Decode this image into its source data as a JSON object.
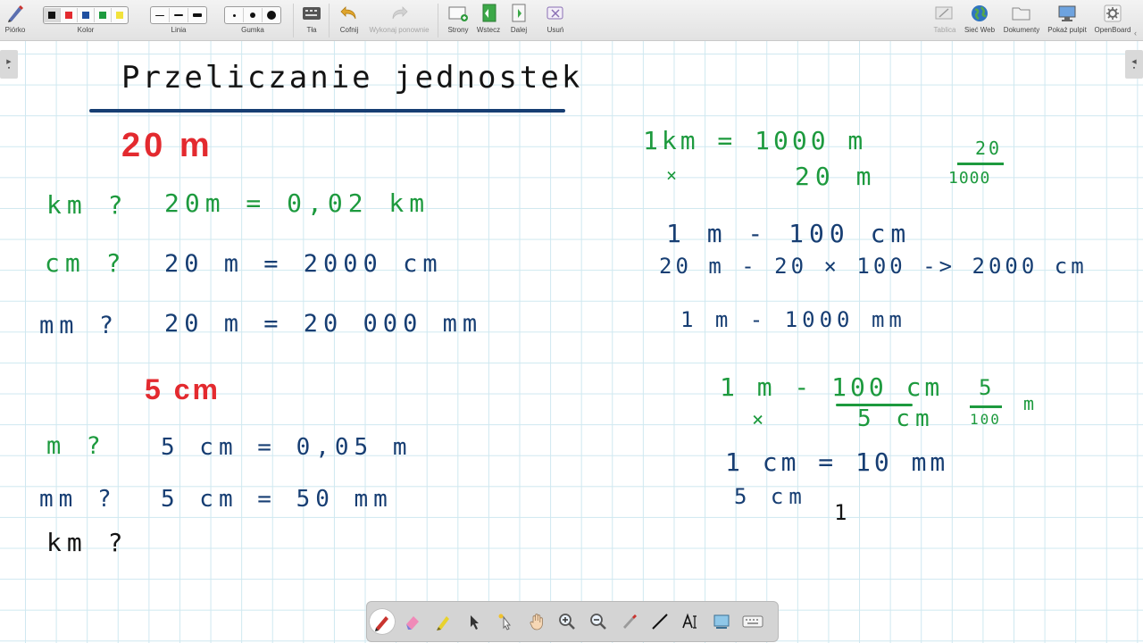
{
  "toolbar": {
    "pen_label": "Piórko",
    "color_label": "Kolor",
    "line_label": "Linia",
    "eraser_label": "Gumka",
    "background_label": "Tła",
    "undo_label": "Cofnij",
    "redo_label": "Wykonaj ponownie",
    "pages_label": "Strony",
    "back_label": "Wstecz",
    "next_label": "Dalej",
    "delete_label": "Usuń",
    "board_label": "Tablica",
    "web_label": "Sieć Web",
    "documents_label": "Dokumenty",
    "desktop_label": "Pokaż pulpit",
    "app_label": "OpenBoard",
    "colors": [
      "#111111",
      "#e32a2f",
      "#1f4fa0",
      "#1d9a3e",
      "#f2e23a"
    ]
  },
  "board": {
    "title": "Przeliczanie jednostek",
    "left": {
      "value_1": "20 m",
      "q1_unit": "km ?",
      "q1_answer": "20m = 0,02 km",
      "q2_unit": "cm ?",
      "q2_answer": "20 m = 2000 cm",
      "q3_unit": "mm ?",
      "q3_answer": "20 m = 20 000 mm",
      "value_2": "5 cm",
      "q4_unit": "m ?",
      "q4_answer": "5 cm = 0,05 m",
      "q5_unit": "mm ?",
      "q5_answer": "5 cm = 50 mm",
      "q6_unit": "km ?"
    },
    "right": {
      "line1": "1km = 1000 m",
      "line2_mark": "×",
      "line2": "20 m",
      "frac1_num": "20",
      "frac1_den": "1000",
      "line3": "1 m - 100 cm",
      "line4": "20 m - 20 × 100 -> 2000 cm",
      "line5": "1 m - 1000 mm",
      "line6": "1 m - 100 cm",
      "line7_mark": "×",
      "line7": "5 cm",
      "frac2_num": "5",
      "frac2_den": "100",
      "frac2_unit": "m",
      "line8": "1 cm = 10 mm",
      "line9": "5 cm",
      "line9_tail": "1"
    }
  },
  "colors": {
    "ink_blue": "#173e73",
    "ink_green": "#1d9a3e",
    "ink_red": "#e32a2f",
    "ink_black": "#141414",
    "grid": "#cfe8f0",
    "title_underline": "#173e73"
  },
  "palette_tools": [
    "pen-icon",
    "highlighter-eraser-icon",
    "marker-icon",
    "pointer-icon",
    "laser-pointer-icon",
    "hand-icon",
    "zoom-in-icon",
    "zoom-out-icon",
    "pipette-icon",
    "line-icon",
    "text-icon",
    "capture-icon",
    "keyboard-icon"
  ]
}
